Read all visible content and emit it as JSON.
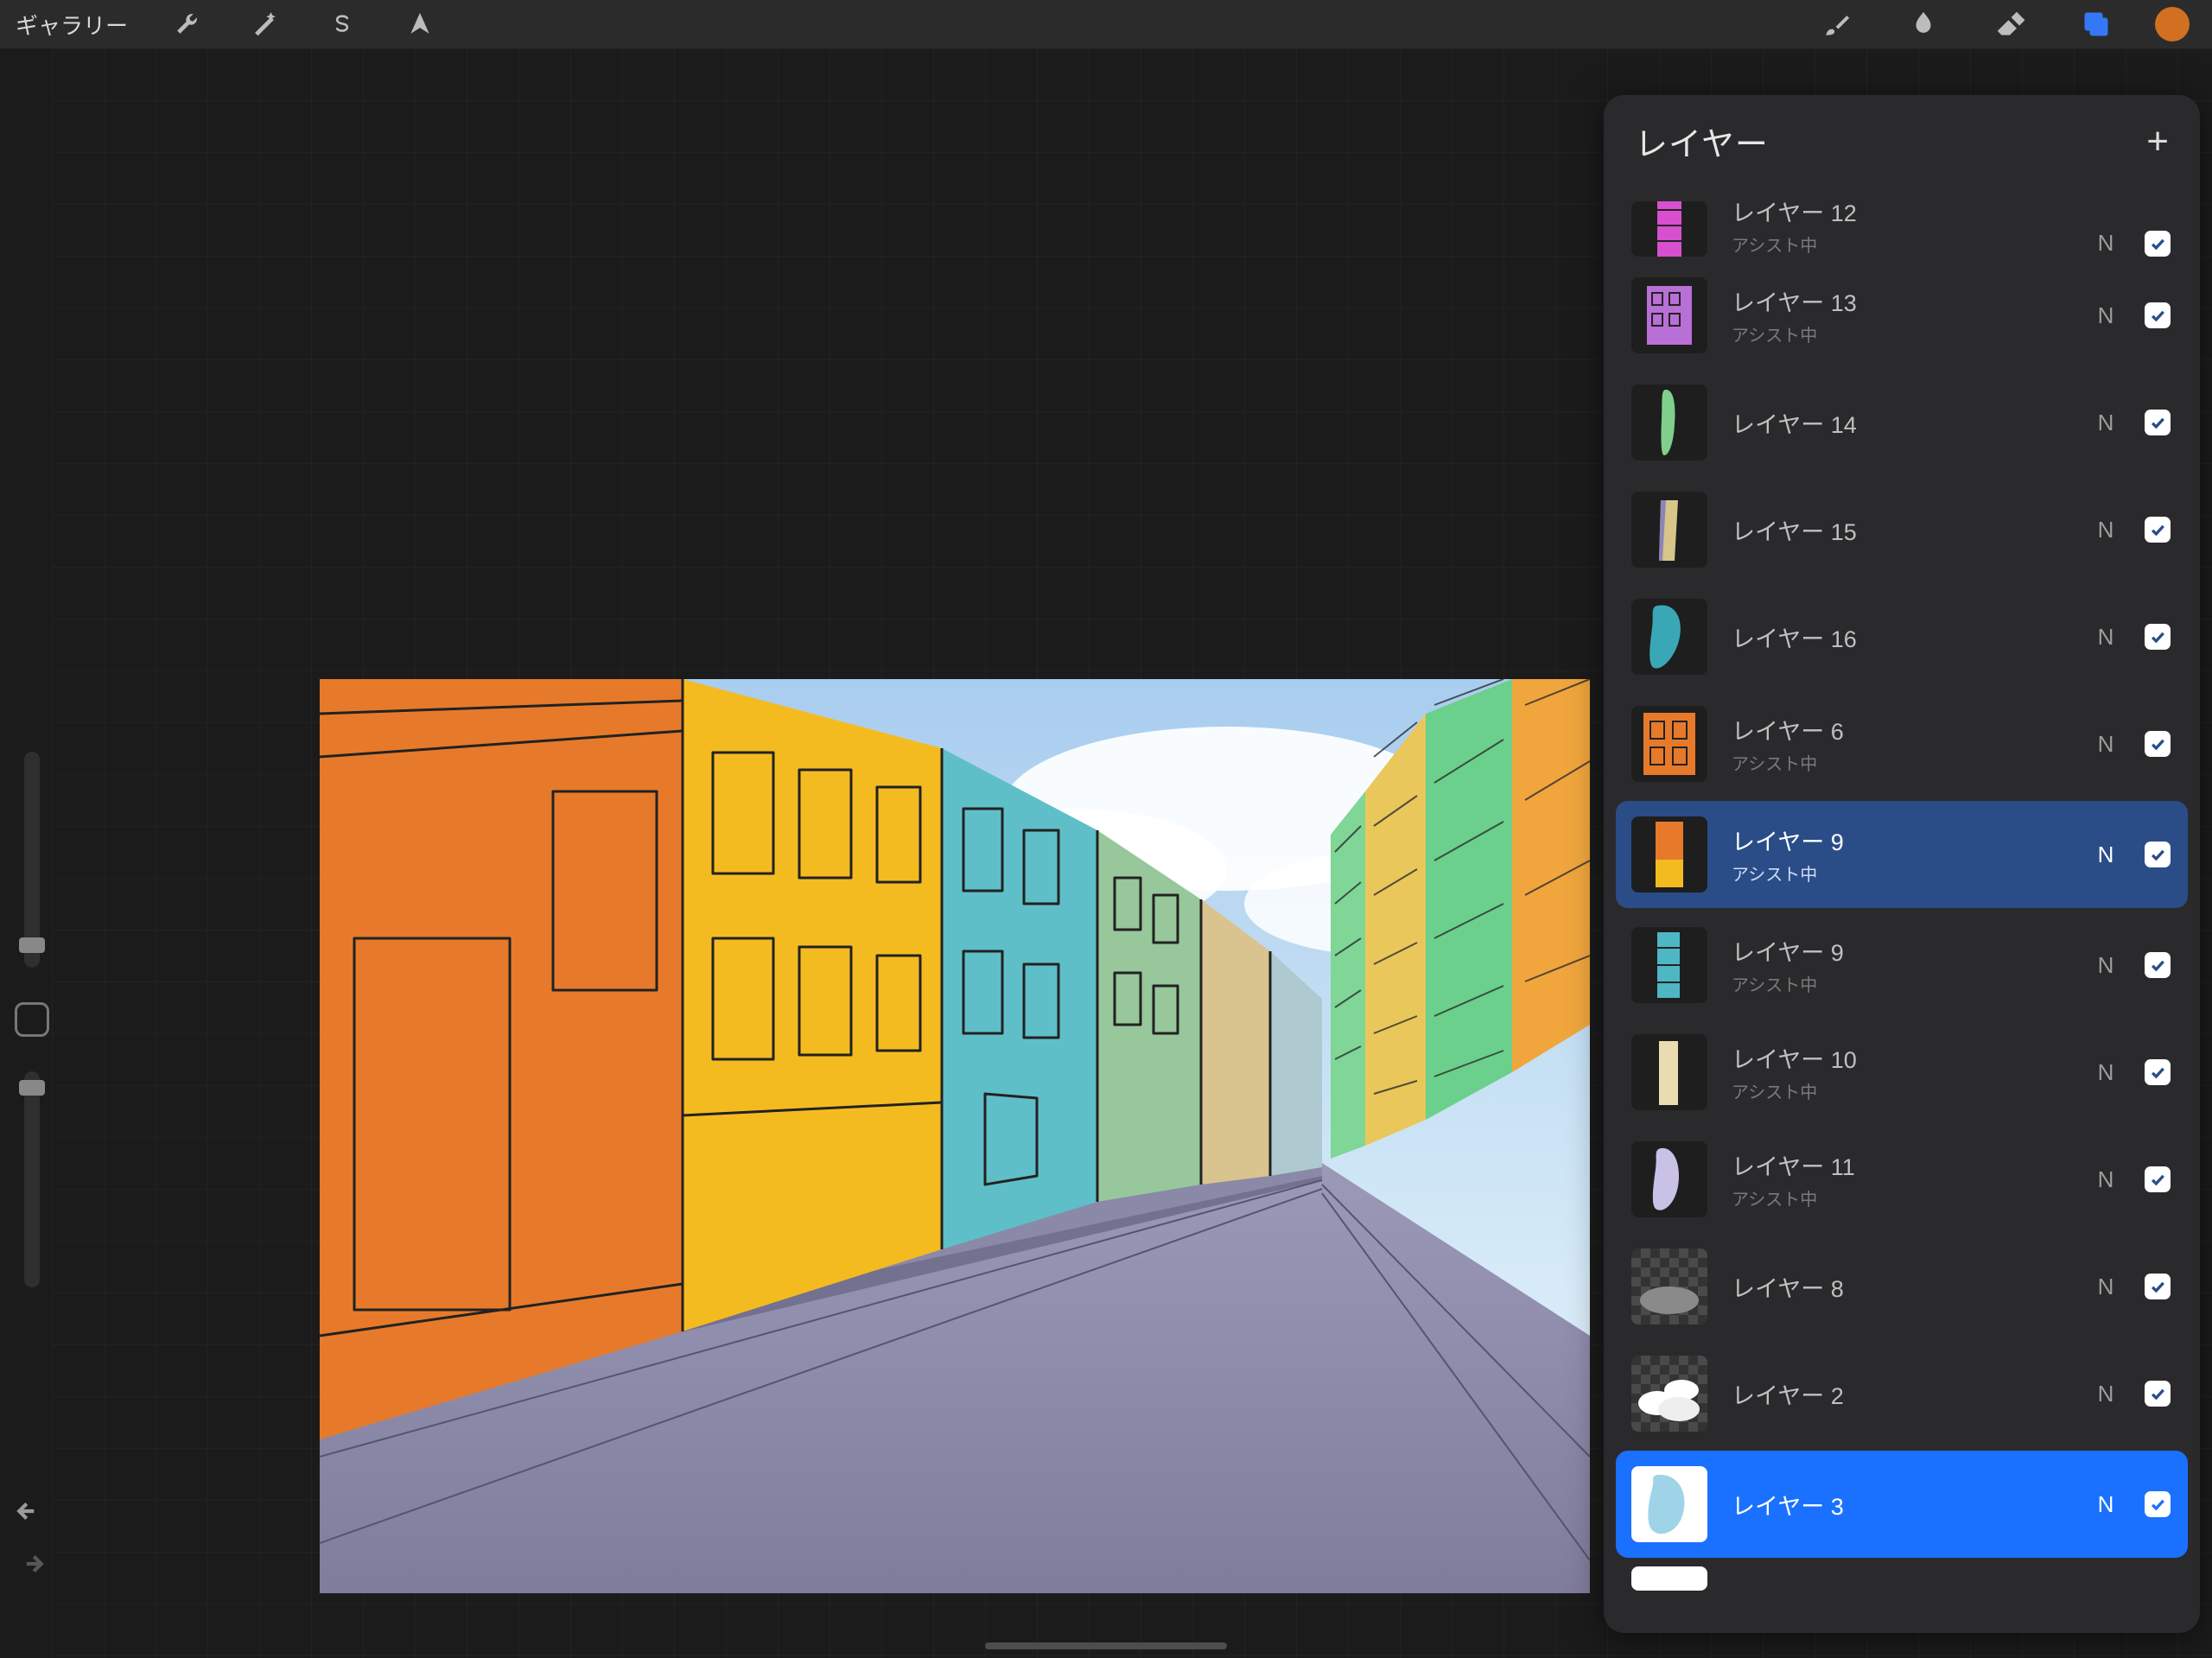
{
  "topbar": {
    "gallery_label": "ギャラリー"
  },
  "panel": {
    "title": "レイヤー",
    "add_label": "+"
  },
  "layers": [
    {
      "name": "レイヤー 12",
      "sub": "アシスト中",
      "blend": "N",
      "visible": true,
      "thumb": "magenta-building",
      "state": "first-partial"
    },
    {
      "name": "レイヤー 13",
      "sub": "アシスト中",
      "blend": "N",
      "visible": true,
      "thumb": "purple-building",
      "state": ""
    },
    {
      "name": "レイヤー 14",
      "sub": "",
      "blend": "N",
      "visible": true,
      "thumb": "green-shape",
      "state": ""
    },
    {
      "name": "レイヤー 15",
      "sub": "",
      "blend": "N",
      "visible": true,
      "thumb": "beige-column",
      "state": ""
    },
    {
      "name": "レイヤー 16",
      "sub": "",
      "blend": "N",
      "visible": true,
      "thumb": "teal-blob",
      "state": ""
    },
    {
      "name": "レイヤー 6",
      "sub": "アシスト中",
      "blend": "N",
      "visible": true,
      "thumb": "orange-facade",
      "state": ""
    },
    {
      "name": "レイヤー 9",
      "sub": "アシスト中",
      "blend": "N",
      "visible": true,
      "thumb": "orange-column",
      "state": "selected-blue-dark"
    },
    {
      "name": "レイヤー 9",
      "sub": "アシスト中",
      "blend": "N",
      "visible": true,
      "thumb": "teal-column",
      "state": ""
    },
    {
      "name": "レイヤー 10",
      "sub": "アシスト中",
      "blend": "N",
      "visible": true,
      "thumb": "cream-column",
      "state": ""
    },
    {
      "name": "レイヤー 11",
      "sub": "アシスト中",
      "blend": "N",
      "visible": true,
      "thumb": "lavender-blob",
      "state": ""
    },
    {
      "name": "レイヤー 8",
      "sub": "",
      "blend": "N",
      "visible": true,
      "thumb": "cloud-gray",
      "state": "",
      "checker": true
    },
    {
      "name": "レイヤー 2",
      "sub": "",
      "blend": "N",
      "visible": true,
      "thumb": "clouds-white",
      "state": "",
      "checker": true
    },
    {
      "name": "レイヤー 3",
      "sub": "",
      "blend": "N",
      "visible": true,
      "thumb": "sky-blue",
      "state": "selected-blue-bright"
    }
  ],
  "colors": {
    "accent": "#d17020",
    "layers_icon": "#3478f6"
  }
}
